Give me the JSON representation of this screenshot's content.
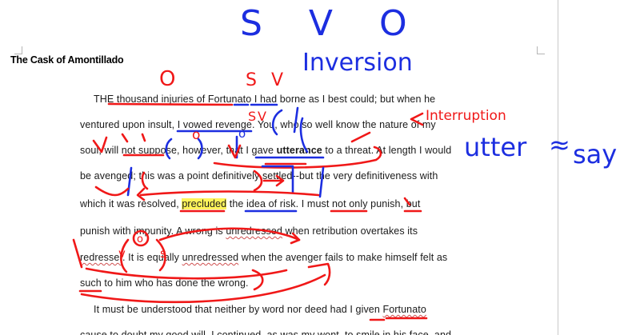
{
  "document": {
    "title": "The Cask of Amontillado",
    "lines": [
      {
        "segments": [
          {
            "t": "THE "
          },
          {
            "t": "thousand injuries of Fortunato"
          },
          {
            "t": " I had borne as I best could; but when he"
          }
        ]
      },
      {
        "segments": [
          {
            "t": "ventured upon insult, I vowed revenge. You, who so well know the nature of my"
          }
        ]
      },
      {
        "segments": [
          {
            "t": "soul, will not suppose, however, that I gave "
          },
          {
            "t": "utterance",
            "style": "bold"
          },
          {
            "t": " to a threat. At length I would"
          }
        ]
      },
      {
        "segments": [
          {
            "t": "be avenged; this was a point definitively settled--but the very definitiveness with"
          }
        ]
      },
      {
        "segments": [
          {
            "t": "which it was resolved, "
          },
          {
            "t": "precluded",
            "style": "hl"
          },
          {
            "t": " the idea of risk. I must not only punish, but"
          }
        ]
      },
      {
        "segments": [
          {
            "t": "punish with impunity. A wrong is "
          },
          {
            "t": "unredressed",
            "style": "sq"
          },
          {
            "t": " when retribution overtakes its"
          }
        ]
      },
      {
        "segments": [
          {
            "t": "redresser",
            "style": "sq"
          },
          {
            "t": ". It is equally "
          },
          {
            "t": "unredressed",
            "style": "sq"
          },
          {
            "t": " when the avenger fails to make himself felt as"
          }
        ]
      },
      {
        "segments": [
          {
            "t": "such to him who has done the wrong."
          }
        ]
      },
      {
        "segments": [
          {
            "t": "It must be understood that neither by word nor deed had I given "
          },
          {
            "t": "Fortunato",
            "style": "sq"
          }
        ]
      },
      {
        "segments": [
          {
            "t": "cause to doubt my good will. I continued, as was my wont, to smile in his face, and"
          }
        ]
      }
    ]
  },
  "annotations": {
    "blue_title": "S V O",
    "inversion": "Inversion",
    "utter_say_left": "utter",
    "utter_say_approx": "≈",
    "utter_say_right": "say",
    "interruption": "Interruption",
    "o_over_thousand": "O",
    "s_mark": "S",
    "v_mark": "V",
    "small_o_1": "o",
    "small_o_2": "o",
    "red_circle_o": "o",
    "small_s": "S",
    "small_v": "V",
    "red_v": "v",
    "red_s": "s",
    "small_v2": "v"
  },
  "colors": {
    "red_ink": "#f01818",
    "blue_ink": "#1c2ee0",
    "highlight": "#fff45a"
  }
}
